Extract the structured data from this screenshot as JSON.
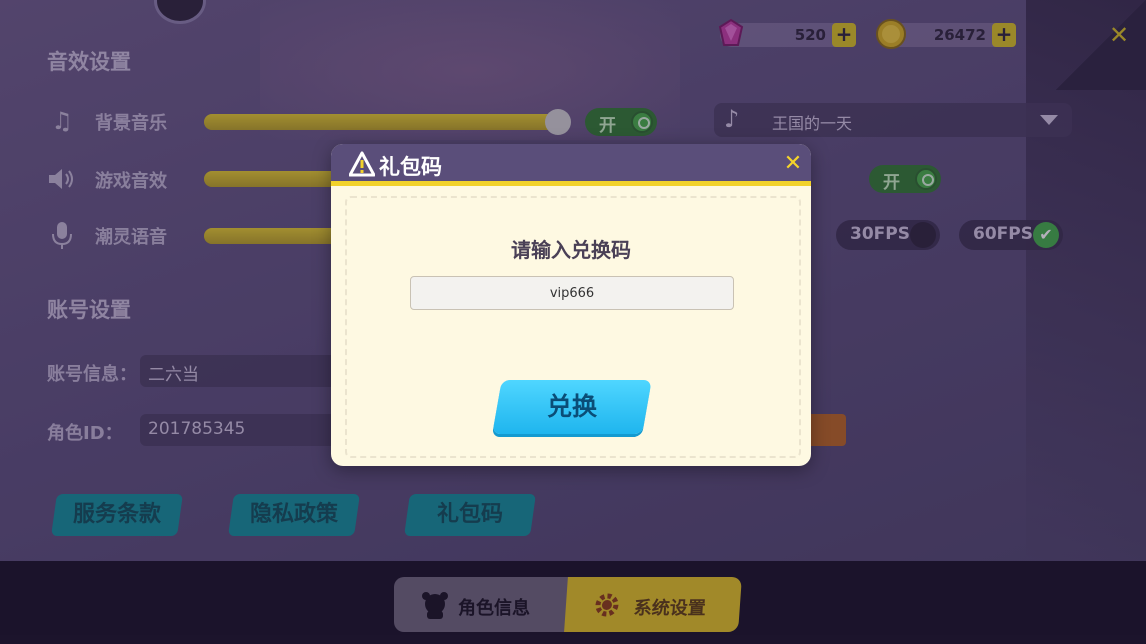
{
  "currency": {
    "gems": "520",
    "coins": "26472",
    "plus": "+"
  },
  "settings": {
    "sound_title": "音效设置",
    "rows": [
      {
        "label": "背景音乐",
        "icon": "music-note-icon",
        "level_pct": 100,
        "toggle": "开"
      },
      {
        "label": "游戏音效",
        "icon": "speaker-icon",
        "toggle": "开"
      },
      {
        "label": "潮灵语音",
        "icon": "microphone-icon"
      }
    ],
    "track_name": "王国的一天",
    "fps_options": [
      "30FPS",
      "60FPS"
    ],
    "fps_selected": "60FPS",
    "account_title": "账号设置",
    "account_info_label": "账号信息：",
    "account_info_value": "二六当",
    "role_id_label": "角色ID：",
    "role_id_value": "201785345",
    "buttons": [
      "服务条款",
      "隐私政策",
      "礼包码"
    ]
  },
  "tabs": [
    {
      "label": "角色信息",
      "icon": "character-icon",
      "active": false
    },
    {
      "label": "系统设置",
      "icon": "gear-icon",
      "active": true
    }
  ],
  "modal": {
    "title": "礼包码",
    "prompt": "请输入兑换码",
    "input_value": "vip666",
    "redeem_label": "兑换"
  },
  "colors": {
    "accent_yellow": "#f2d22a",
    "redeem_blue": "#1fb5ee",
    "header_purple": "#5a4e7a"
  }
}
